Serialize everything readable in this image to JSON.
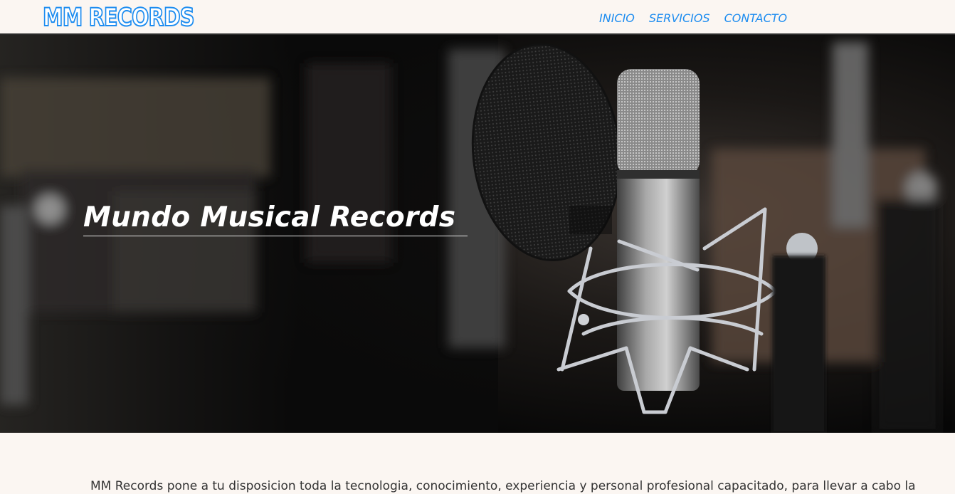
{
  "header": {
    "logo_text": "MM RECORDS",
    "nav": [
      {
        "label": "INICIO"
      },
      {
        "label": "SERVICIOS"
      },
      {
        "label": "CONTACTO"
      }
    ],
    "accent_color": "#1c8cf0"
  },
  "hero": {
    "title": "Mundo Musical Records",
    "image_subject": "studio-condenser-microphone-with-pop-filter"
  },
  "intro": {
    "text": "MM Records pone a tu disposicion toda la tecnologia, conocimiento, experiencia y personal profesional capacitado, para llevar a cabo la"
  }
}
